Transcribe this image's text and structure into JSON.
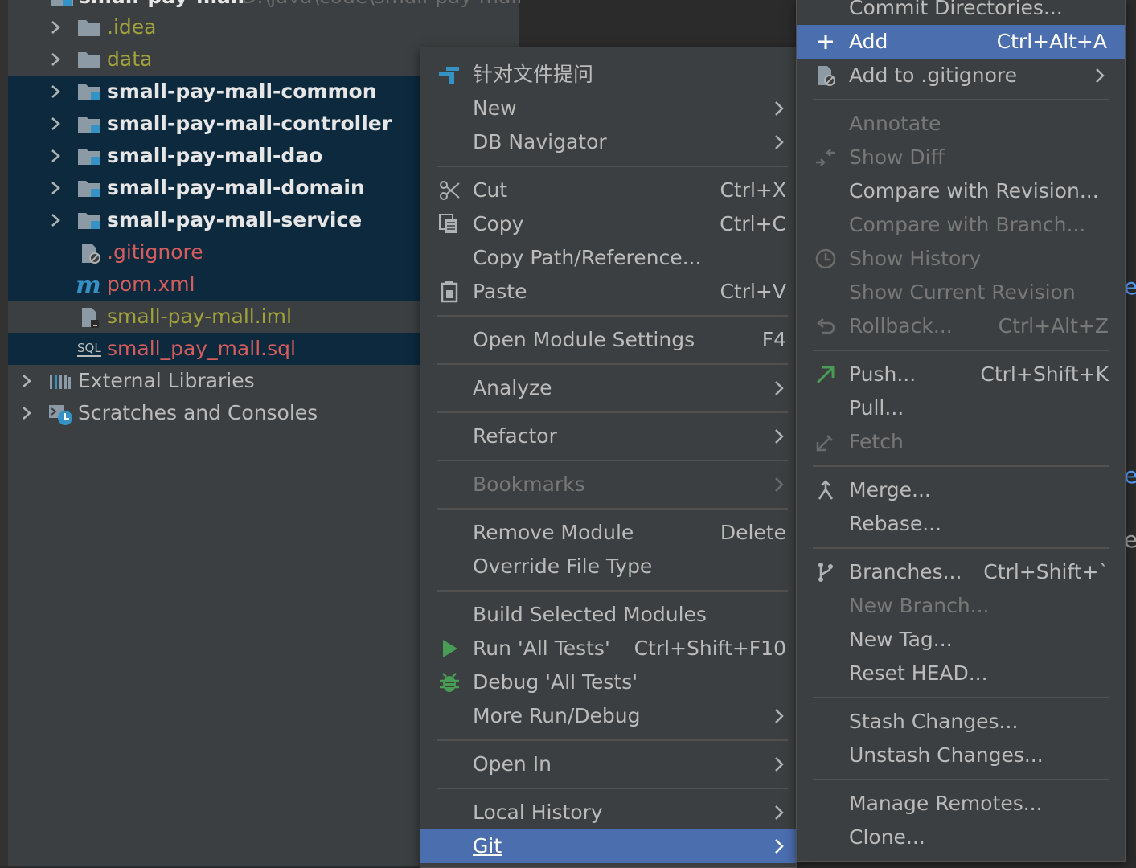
{
  "project": {
    "root_label": "small-pay-mall",
    "root_path": "D:\\java\\code\\small-pay-mall",
    "items": [
      {
        "label": ".idea"
      },
      {
        "label": "data"
      },
      {
        "label": "small-pay-mall-common"
      },
      {
        "label": "small-pay-mall-controller"
      },
      {
        "label": "small-pay-mall-dao"
      },
      {
        "label": "small-pay-mall-domain"
      },
      {
        "label": "small-pay-mall-service"
      },
      {
        "label": ".gitignore"
      },
      {
        "label": "pom.xml"
      },
      {
        "label": "small-pay-mall.iml"
      },
      {
        "label": "small_pay_mall.sql"
      },
      {
        "label": "External Libraries"
      },
      {
        "label": "Scratches and Consoles"
      }
    ]
  },
  "context_menu": {
    "items": [
      {
        "label": "针对文件提问"
      },
      {
        "label": "New"
      },
      {
        "label": "DB Navigator"
      },
      {
        "label": "Cut",
        "shortcut": "Ctrl+X"
      },
      {
        "label": "Copy",
        "shortcut": "Ctrl+C"
      },
      {
        "label": "Copy Path/Reference..."
      },
      {
        "label": "Paste",
        "shortcut": "Ctrl+V"
      },
      {
        "label": "Open Module Settings",
        "shortcut": "F4"
      },
      {
        "label": "Analyze"
      },
      {
        "label": "Refactor"
      },
      {
        "label": "Bookmarks"
      },
      {
        "label": "Remove Module",
        "shortcut": "Delete"
      },
      {
        "label": "Override File Type"
      },
      {
        "label": "Build Selected Modules"
      },
      {
        "label": "Run 'All Tests'",
        "shortcut": "Ctrl+Shift+F10"
      },
      {
        "label": "Debug 'All Tests'"
      },
      {
        "label": "More Run/Debug"
      },
      {
        "label": "Open In"
      },
      {
        "label": "Local History"
      },
      {
        "label": "Git"
      }
    ]
  },
  "git_menu": {
    "items": [
      {
        "label": "Commit Directories..."
      },
      {
        "label": "Add",
        "shortcut": "Ctrl+Alt+A"
      },
      {
        "label": "Add to .gitignore"
      },
      {
        "label": "Annotate"
      },
      {
        "label": "Show Diff"
      },
      {
        "label": "Compare with Revision..."
      },
      {
        "label": "Compare with Branch..."
      },
      {
        "label": "Show History"
      },
      {
        "label": "Show Current Revision"
      },
      {
        "label": "Rollback...",
        "shortcut": "Ctrl+Alt+Z"
      },
      {
        "label": "Push...",
        "shortcut": "Ctrl+Shift+K"
      },
      {
        "label": "Pull..."
      },
      {
        "label": "Fetch"
      },
      {
        "label": "Merge..."
      },
      {
        "label": "Rebase..."
      },
      {
        "label": "Branches...",
        "shortcut": "Ctrl+Shift+`"
      },
      {
        "label": "New Branch..."
      },
      {
        "label": "New Tag..."
      },
      {
        "label": "Reset HEAD..."
      },
      {
        "label": "Stash Changes..."
      },
      {
        "label": "Unstash Changes..."
      },
      {
        "label": "Manage Remotes..."
      },
      {
        "label": "Clone..."
      }
    ]
  },
  "editor_fragments": [
    "e",
    "e",
    "e"
  ],
  "colors": {
    "menu_bg": "#3c3f41",
    "highlight": "#4b6eaf",
    "selection": "#0d293e",
    "untracked_red": "#d55d5d",
    "ignored_olive": "#a2a23b"
  }
}
